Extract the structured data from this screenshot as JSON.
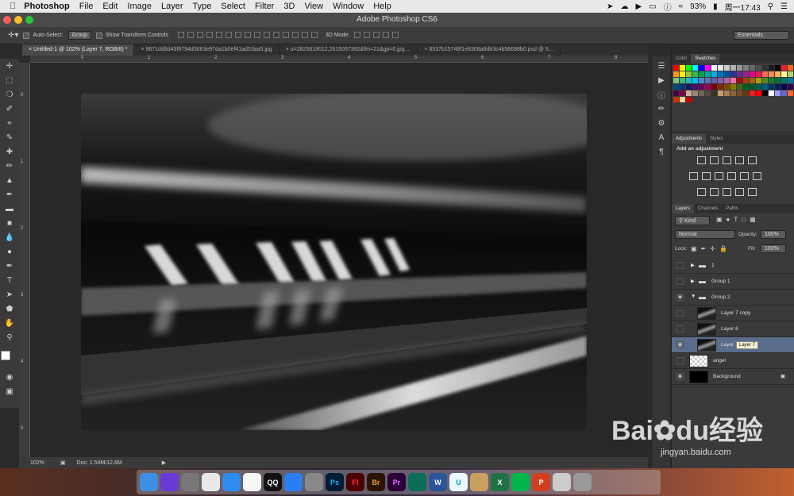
{
  "menubar": {
    "app": "Photoshop",
    "items": [
      "File",
      "Edit",
      "Image",
      "Layer",
      "Type",
      "Select",
      "Filter",
      "3D",
      "View",
      "Window",
      "Help"
    ],
    "battery": "93%",
    "clock": "周一17:43"
  },
  "window": {
    "title": "Adobe Photoshop CS6"
  },
  "options": {
    "auto_select": "Auto-Select:",
    "auto_select_value": "Group",
    "show_transform": "Show Transform Controls",
    "mode_3d": "3D Mode:",
    "workspace": "Essentials"
  },
  "tabs": [
    "Untitled-1 @ 102% (Layer 7, RGB/8) *",
    "9671dd8d43f8794d3663e97da1b0ef41ad53aa5.jpg",
    "u=2825619012,2615057392&fm=21&gp=0.jpg ...",
    "8537b15748f1e8308a8db3c4b58698b0.psd @ 5..."
  ],
  "ruler_top": [
    "0",
    "1",
    "2",
    "3",
    "4",
    "5",
    "6",
    "7",
    "8"
  ],
  "ruler_left": [
    "0",
    "1",
    "2",
    "3",
    "4",
    "5"
  ],
  "status": {
    "zoom": "102%",
    "doc": "Doc: 1.54M/12.8M"
  },
  "color_panel": {
    "tabs": [
      "Color",
      "Swatches"
    ]
  },
  "adjustments": {
    "tabs": [
      "Adjustments",
      "Styles"
    ],
    "heading": "Add an adjustment"
  },
  "layers_panel": {
    "tabs": [
      "Layers",
      "Channels",
      "Paths"
    ],
    "kind": "Kind",
    "blend": "Normal",
    "opacity_label": "Opacity:",
    "opacity": "100%",
    "lock_label": "Lock:",
    "fill_label": "Fill:",
    "fill": "100%",
    "tooltip": "Layer 7",
    "layers": [
      {
        "name": "1",
        "type": "group",
        "visible": false,
        "indent": 0
      },
      {
        "name": "Group 1",
        "type": "group",
        "visible": false,
        "indent": 0
      },
      {
        "name": "Group 2",
        "type": "group-open",
        "visible": true,
        "indent": 0
      },
      {
        "name": "Layer 7 copy",
        "type": "layer",
        "visible": false,
        "indent": 1
      },
      {
        "name": "Layer 6",
        "type": "layer",
        "visible": false,
        "indent": 1
      },
      {
        "name": "Layer 7",
        "type": "layer",
        "visible": true,
        "indent": 1,
        "selected": true
      },
      {
        "name": "angel",
        "type": "layer",
        "visible": false,
        "indent": 0
      },
      {
        "name": "Background",
        "type": "background",
        "visible": true,
        "indent": 0
      }
    ]
  },
  "dock": [
    "Finder",
    "Siri",
    "Launchpad",
    "Chrome",
    "Safari",
    "Photos",
    "QQ",
    "App Store",
    "Preferences",
    "Ps",
    "Fl",
    "Br",
    "Pr",
    "Edge",
    "W",
    "U",
    "Archive",
    "X",
    "iQIYI",
    "P",
    "Preview",
    "Trash"
  ],
  "watermark": {
    "brand": "Bai",
    "brand2": "du",
    "cn": "经验",
    "url": "jingyan.baidu.com"
  }
}
